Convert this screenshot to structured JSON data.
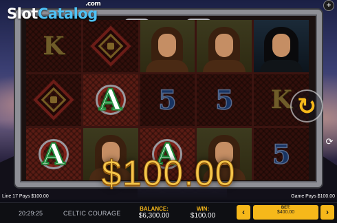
{
  "logo": {
    "slot": "Slot",
    "catalog": "Catalog",
    "com": ".com"
  },
  "game": {
    "win_amount": "$100.00",
    "line_info": "Line 17 Pays $100.00",
    "game_pays": "Game Pays $100.00"
  },
  "reels": [
    [
      {
        "symbol": "K",
        "kind": "letter",
        "dim": true
      },
      {
        "symbol": "celtic-knot",
        "kind": "knot",
        "dim": true
      },
      {
        "symbol": "A",
        "kind": "letter",
        "dim": false
      }
    ],
    [
      {
        "symbol": "celtic-knot",
        "kind": "knot",
        "dim": true
      },
      {
        "symbol": "A",
        "kind": "letter",
        "dim": false
      },
      {
        "symbol": "warrior",
        "kind": "portrait",
        "dim": false
      }
    ],
    [
      {
        "symbol": "warrior",
        "kind": "portrait",
        "dim": false
      },
      {
        "symbol": "5",
        "kind": "letter",
        "dim": true
      },
      {
        "symbol": "A",
        "kind": "letter",
        "dim": false
      }
    ],
    [
      {
        "symbol": "warrior",
        "kind": "portrait",
        "dim": false
      },
      {
        "symbol": "5",
        "kind": "letter",
        "dim": true
      },
      {
        "symbol": "warrior",
        "kind": "portrait",
        "dim": false
      }
    ],
    [
      {
        "symbol": "hooded-warrior",
        "kind": "portrait",
        "dim": false
      },
      {
        "symbol": "K",
        "kind": "letter",
        "dim": true
      },
      {
        "symbol": "5",
        "kind": "letter",
        "dim": true
      }
    ]
  ],
  "bottom_bar": {
    "time": "20:29:25",
    "game_name": "CELTIC COURAGE",
    "balance_label": "BALANCE:",
    "balance_value": "$6,300.00",
    "win_label": "WIN:",
    "win_value": "$100.00",
    "bet_label": "BET:",
    "bet_value": "$400.00"
  },
  "icons": {
    "spin": "spin-arrow-icon",
    "autoplay": "autoplay-icon",
    "plus": "plus-icon",
    "bet_decrease": "chevron-left-icon",
    "bet_increase": "chevron-right-icon"
  },
  "colors": {
    "accent": "#f6b81a",
    "win_gold": "#f6c64a",
    "logo_blue": "#4fc3f7"
  }
}
